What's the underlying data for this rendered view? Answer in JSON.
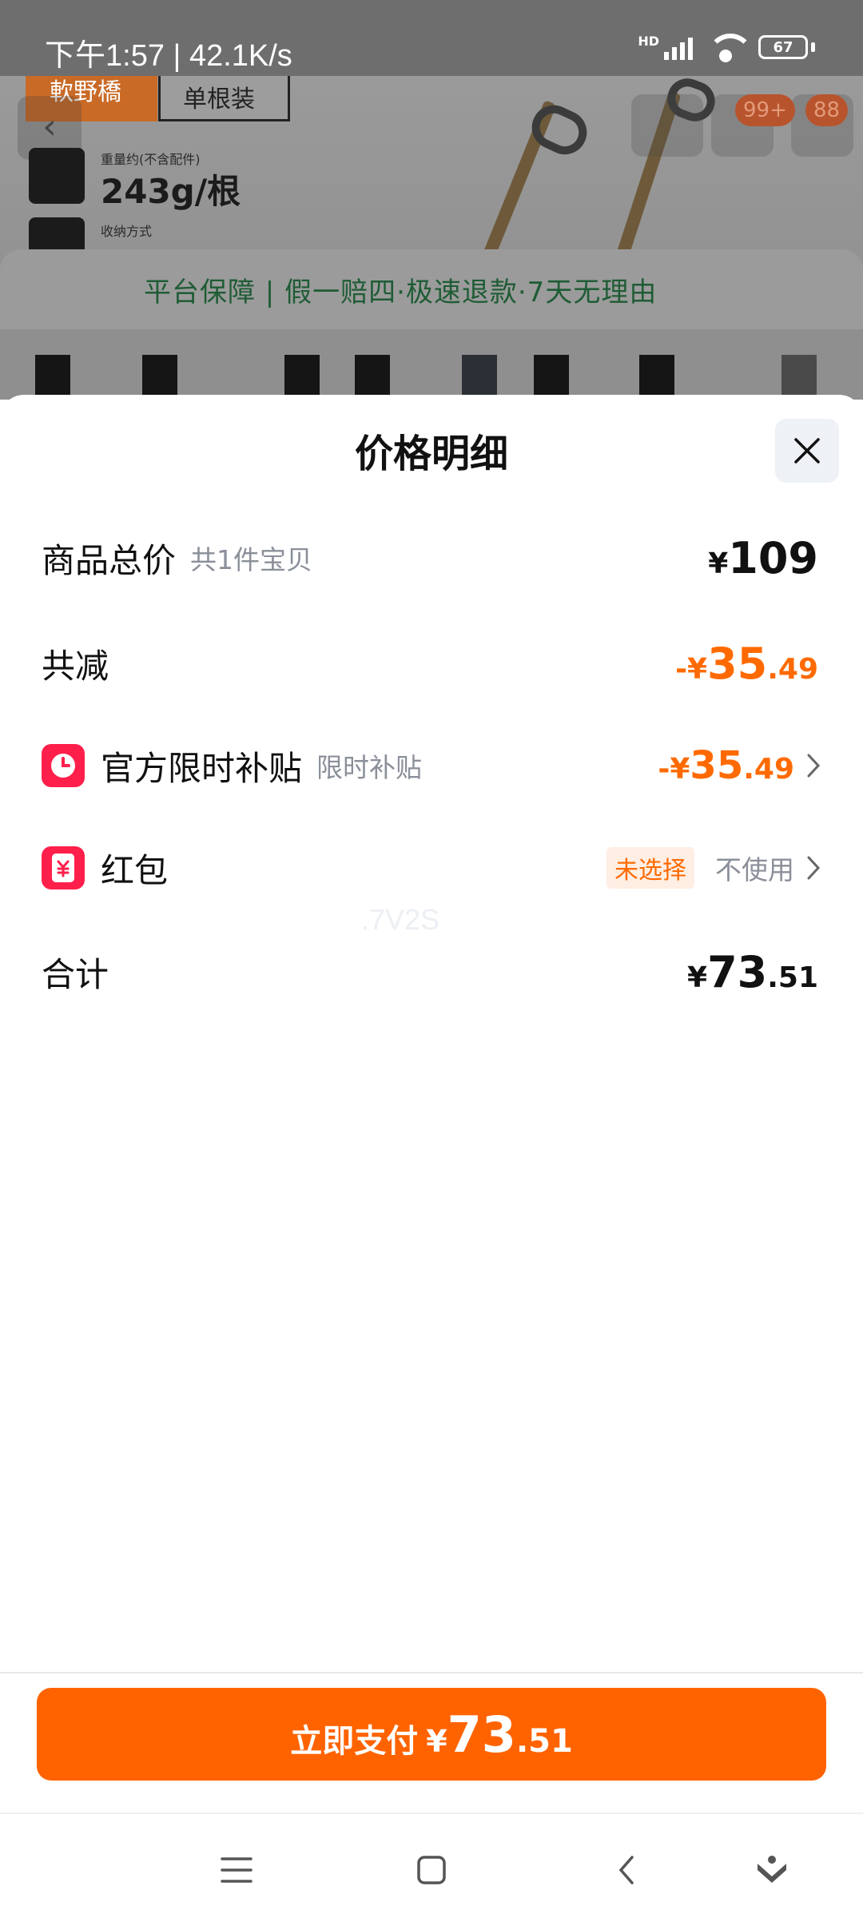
{
  "status_bar": {
    "time_speed": "下午1:57 | 42.1K/s",
    "network_label": "HD",
    "battery": "67"
  },
  "background": {
    "tag_orange": "軟野橋",
    "tag_white": "单根装",
    "weight_label": "重量约(不含配件)",
    "weight_value": "243g/根",
    "fold_label": "收纳方式",
    "cart_badge": "99+",
    "more_badge": "88",
    "guarantee": "平台保障 | 假一赔四·极速退款·7天无理由"
  },
  "sheet": {
    "title": "价格明细",
    "rows": {
      "total": {
        "label": "商品总价",
        "sub": "共1件宝贝",
        "yen": "¥",
        "int": "109",
        "dec": ""
      },
      "discount": {
        "label": "共减",
        "yen": "-¥",
        "int": "35",
        "dec": ".49"
      },
      "subsidy": {
        "label": "官方限时补贴",
        "sub": "限时补贴",
        "yen": "-¥",
        "int": "35",
        "dec": ".49"
      },
      "redpacket": {
        "label": "红包",
        "tag": "未选择",
        "note": "不使用"
      },
      "sum": {
        "label": "合计",
        "yen": "¥",
        "int": "73",
        "dec": ".51"
      }
    },
    "watermark": ".7V2S"
  },
  "pay": {
    "label": "立即支付",
    "yen": "¥",
    "int": "73",
    "dec": ".51"
  },
  "colors": {
    "accent": "#ff6300",
    "discount": "#ff6a00",
    "icon_red": "#ff1f4b"
  },
  "icons": [
    "close-icon",
    "clock-icon",
    "red-packet-icon",
    "chevron-right-icon",
    "menu-icon",
    "home-icon",
    "back-icon",
    "assistant-icon"
  ]
}
